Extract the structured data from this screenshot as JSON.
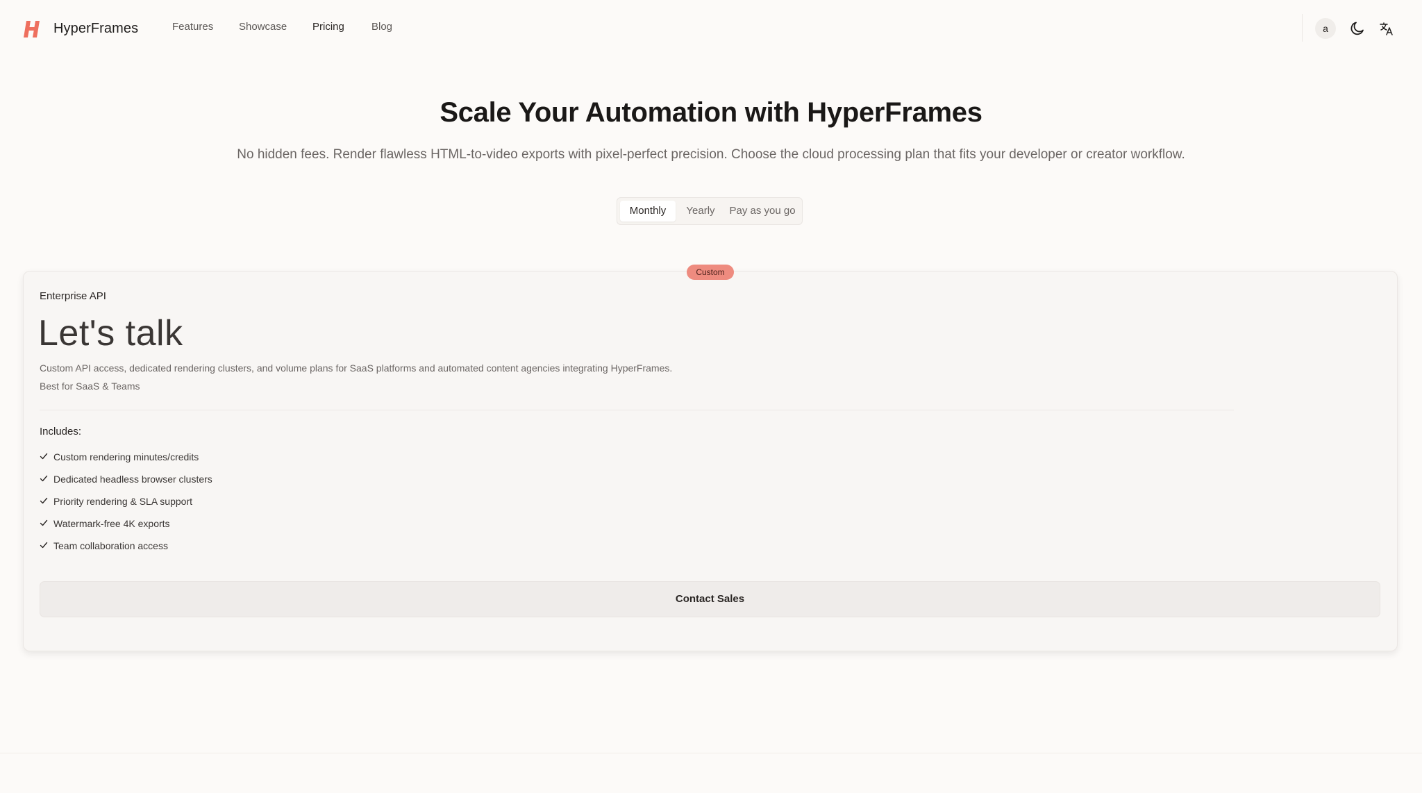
{
  "header": {
    "brand": "HyperFrames",
    "logo_icon": "hyperframes-logo-icon",
    "nav": [
      {
        "label": "Features",
        "active": false
      },
      {
        "label": "Showcase",
        "active": false
      },
      {
        "label": "Pricing",
        "active": true
      },
      {
        "label": "Blog",
        "active": false
      }
    ],
    "avatar_initial": "a",
    "theme_icon": "moon-icon",
    "language_icon": "translate-icon"
  },
  "hero": {
    "title": "Scale Your Automation with HyperFrames",
    "subtitle": "No hidden fees. Render flawless HTML-to-video exports with pixel-perfect precision. Choose the cloud processing plan that fits your developer or creator workflow."
  },
  "billing_toggle": {
    "options": [
      "Monthly",
      "Yearly",
      "Pay as you go"
    ],
    "selected": "Monthly"
  },
  "plan": {
    "badge": "Custom",
    "name": "Enterprise API",
    "price": "Let's talk",
    "description": "Custom API access, dedicated rendering clusters, and volume plans for SaaS platforms and automated content agencies integrating HyperFrames.",
    "audience": "Best for SaaS & Teams",
    "includes_label": "Includes:",
    "features": [
      "Custom rendering minutes/credits",
      "Dedicated headless browser clusters",
      "Priority rendering & SLA support",
      "Watermark-free 4K exports",
      "Team collaboration access"
    ],
    "cta": "Contact Sales"
  },
  "colors": {
    "background": "#fcfaf8",
    "brand_accent": "#ee6f5e",
    "badge": "#ee8b7f",
    "text_primary": "#1f1d1c",
    "text_muted": "#6b6664"
  }
}
